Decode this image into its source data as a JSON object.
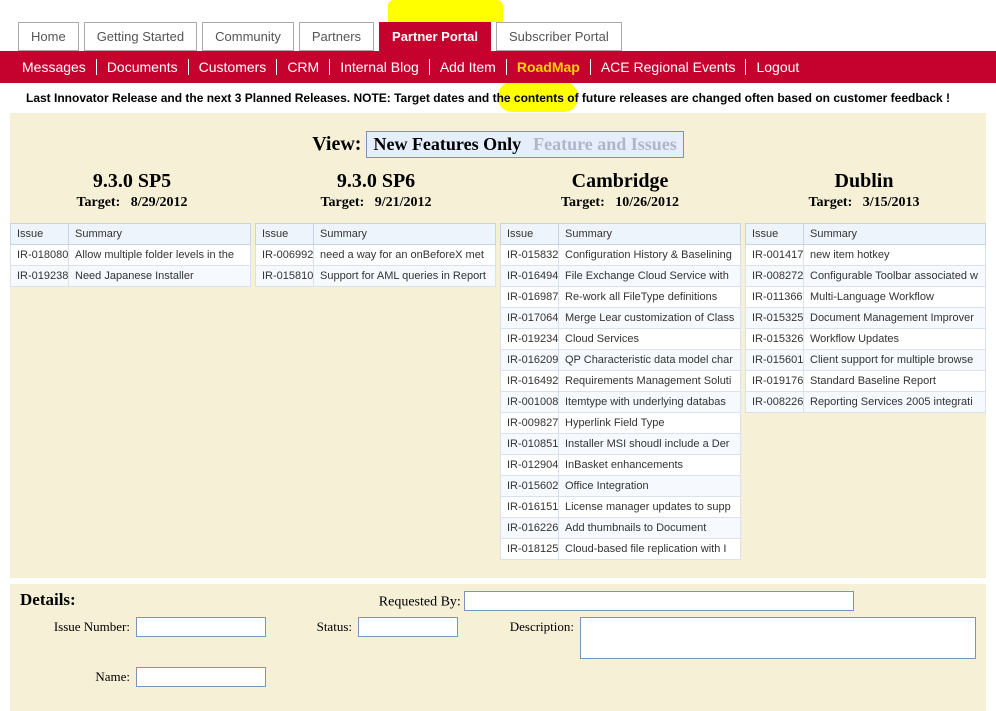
{
  "tabs": [
    "Home",
    "Getting Started",
    "Community",
    "Partners",
    "Partner Portal",
    "Subscriber Portal"
  ],
  "active_tab": 4,
  "subnav": [
    "Messages",
    "Documents",
    "Customers",
    "CRM",
    "Internal Blog",
    "Add Item",
    "RoadMap",
    "ACE Regional Events",
    "Logout"
  ],
  "active_subnav": 6,
  "note": "Last Innovator Release and the next 3 Planned Releases. NOTE: Target dates and the contents of future releases are changed often based on customer feedback !",
  "view_label": "View:",
  "toggle": {
    "a": "New Features Only",
    "b": "Feature and Issues"
  },
  "target_label": "Target:",
  "col_issue": "Issue",
  "col_summary": "Summary",
  "releases": [
    {
      "name": "9.3.0 SP5",
      "target": "8/29/2012",
      "rows": [
        {
          "id": "IR-018080",
          "sum": "Allow multiple folder levels in the"
        },
        {
          "id": "IR-019238",
          "sum": "Need Japanese Installer"
        }
      ]
    },
    {
      "name": "9.3.0 SP6",
      "target": "9/21/2012",
      "rows": [
        {
          "id": "IR-006992",
          "sum": "need a way for an onBeforeX met"
        },
        {
          "id": "IR-015810",
          "sum": "Support for AML queries in Report"
        }
      ]
    },
    {
      "name": "Cambridge",
      "target": "10/26/2012",
      "rows": [
        {
          "id": "IR-015832",
          "sum": "Configuration History & Baselining"
        },
        {
          "id": "IR-016494",
          "sum": "File Exchange Cloud Service with"
        },
        {
          "id": "IR-016987",
          "sum": "Re-work all FileType definitions"
        },
        {
          "id": "IR-017064",
          "sum": "Merge Lear customization of Class"
        },
        {
          "id": "IR-019234",
          "sum": "Cloud Services"
        },
        {
          "id": "IR-016209",
          "sum": "QP Characteristic data model char"
        },
        {
          "id": "IR-016492",
          "sum": "Requirements Management Soluti"
        },
        {
          "id": "IR-001008",
          "sum": "Itemtype with underlying databas"
        },
        {
          "id": "IR-009827",
          "sum": "Hyperlink Field Type"
        },
        {
          "id": "IR-010851",
          "sum": "Installer MSI shoudl include a Der"
        },
        {
          "id": "IR-012904",
          "sum": "InBasket enhancements"
        },
        {
          "id": "IR-015602",
          "sum": "Office Integration"
        },
        {
          "id": "IR-016151",
          "sum": "License manager updates to supp"
        },
        {
          "id": "IR-016226",
          "sum": "Add thumbnails to Document"
        },
        {
          "id": "IR-018125",
          "sum": "Cloud-based file replication with I"
        }
      ]
    },
    {
      "name": "Dublin",
      "target": "3/15/2013",
      "rows": [
        {
          "id": "IR-001417",
          "sum": "new item hotkey"
        },
        {
          "id": "IR-008272",
          "sum": "Configurable Toolbar associated w"
        },
        {
          "id": "IR-011366",
          "sum": "Multi-Language Workflow"
        },
        {
          "id": "IR-015325",
          "sum": "Document Management Improver"
        },
        {
          "id": "IR-015326",
          "sum": "Workflow Updates"
        },
        {
          "id": "IR-015601",
          "sum": "Client support for multiple browse"
        },
        {
          "id": "IR-019176",
          "sum": "Standard Baseline Report"
        },
        {
          "id": "IR-008226",
          "sum": "Reporting Services 2005 integrati"
        }
      ]
    }
  ],
  "details": {
    "title": "Details:",
    "requested_by": "Requested By:",
    "issue_number": "Issue Number:",
    "status": "Status:",
    "description": "Description:",
    "name": "Name:",
    "values": {
      "requested_by": "",
      "issue_number": "",
      "status": "",
      "description": "",
      "name": ""
    }
  }
}
